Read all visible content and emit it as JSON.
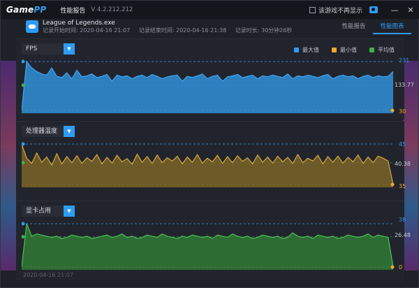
{
  "titlebar": {
    "brand_a": "Game",
    "brand_b": "PP",
    "title": "性能报告",
    "version": "V 4.2.212.212",
    "no_show_label": "该游戏不再显示",
    "camera_icon": "camera-icon",
    "min_symbol": "—",
    "close_symbol": "✕"
  },
  "header": {
    "app_name": "League of Legends.exe",
    "start_label": "记录开始时间: 2020-04-16 21:07",
    "end_label": "记录结束时间: 2020-04-16 21:38",
    "duration_label": "记录时长: 30分钟26秒",
    "tabs": [
      "性能报告",
      "性能图表"
    ],
    "active_tab": 1
  },
  "legend": {
    "max": "最大值",
    "min": "最小值",
    "avg": "平均值",
    "max_color": "#2e9cf2",
    "min_color": "#f0a830",
    "avg_color": "#3fb24b"
  },
  "panels": [
    {
      "dropdown": "FPS",
      "max": "231",
      "avg": "133.77",
      "min": "30",
      "color": "#2f8fd8",
      "line": "#3fa6f5"
    },
    {
      "dropdown": "处理器温度",
      "max": "45",
      "avg": "40.38",
      "min": "35",
      "color": "#7a6428",
      "line": "#d6a83e"
    },
    {
      "dropdown": "显卡占用",
      "max": "38",
      "avg": "26.48",
      "min": "0",
      "color": "#2f7a35",
      "line": "#4cc257"
    }
  ],
  "chart_data": [
    {
      "type": "area",
      "title": "FPS",
      "ylim": [
        30,
        231
      ],
      "series": [
        {
          "values": [
            30,
            231,
            205,
            190,
            180,
            175,
            205,
            170,
            165,
            185,
            160,
            195,
            168,
            172,
            180,
            165,
            170,
            178,
            150,
            175,
            168,
            172,
            160,
            170,
            175,
            165,
            178,
            170,
            160,
            168,
            172,
            175,
            150,
            170,
            165,
            172,
            180,
            160,
            170,
            175,
            150,
            168,
            172,
            178,
            165,
            170,
            175,
            160,
            172,
            168,
            175,
            170,
            165,
            180,
            160,
            172,
            168,
            175,
            170,
            165,
            172,
            178,
            160,
            170,
            175,
            168,
            172,
            160,
            170,
            175,
            165,
            172,
            168,
            170,
            190
          ]
        }
      ]
    },
    {
      "type": "area",
      "title": "处理器温度",
      "ylim": [
        35,
        45
      ],
      "series": [
        {
          "values": [
            45,
            41.5,
            40.2,
            42.8,
            40.5,
            41.8,
            39.8,
            42.6,
            40.1,
            41.9,
            40.4,
            42.1,
            40.2,
            41.6,
            40.7,
            42.4,
            40.1,
            41.7,
            40.3,
            42.2,
            40.6,
            41.4,
            40.0,
            42.5,
            40.5,
            41.9,
            40.2,
            42.3,
            40.4,
            41.6,
            40.8,
            42.0,
            40.1,
            41.8,
            40.5,
            42.4,
            40.3,
            41.5,
            40.6,
            42.2,
            40.2,
            41.9,
            40.4,
            42.1,
            40.7,
            41.6,
            40.1,
            42.3,
            40.5,
            41.8,
            40.3,
            42.0,
            40.6,
            41.7,
            40.2,
            42.4,
            40.4,
            41.5,
            40.8,
            42.2,
            40.1,
            41.9,
            40.5,
            42.0,
            40.3,
            41.7,
            40.6,
            42.3,
            40.2,
            41.8,
            40.4,
            42.0,
            41.5,
            40.8,
            35
          ]
        }
      ]
    },
    {
      "type": "area",
      "title": "显卡占用",
      "ylim": [
        0,
        38
      ],
      "series": [
        {
          "values": [
            0,
            38,
            27,
            29,
            28,
            27,
            26,
            27,
            25,
            26,
            28,
            27,
            26,
            27,
            25,
            26,
            27,
            28,
            26,
            27,
            29,
            26,
            27,
            25,
            26,
            28,
            27,
            26,
            29,
            27,
            26,
            25,
            27,
            26,
            28,
            27,
            26,
            27,
            25,
            28,
            27,
            26,
            29,
            27,
            26,
            27,
            25,
            26,
            28,
            27,
            26,
            27,
            25,
            26,
            30,
            27,
            26,
            27,
            25,
            28,
            27,
            26,
            27,
            25,
            26,
            28,
            27,
            26,
            27,
            29,
            26,
            28,
            27,
            26,
            0
          ]
        }
      ]
    }
  ],
  "footer": {
    "timestamp": "2020-04-16 21:07"
  }
}
